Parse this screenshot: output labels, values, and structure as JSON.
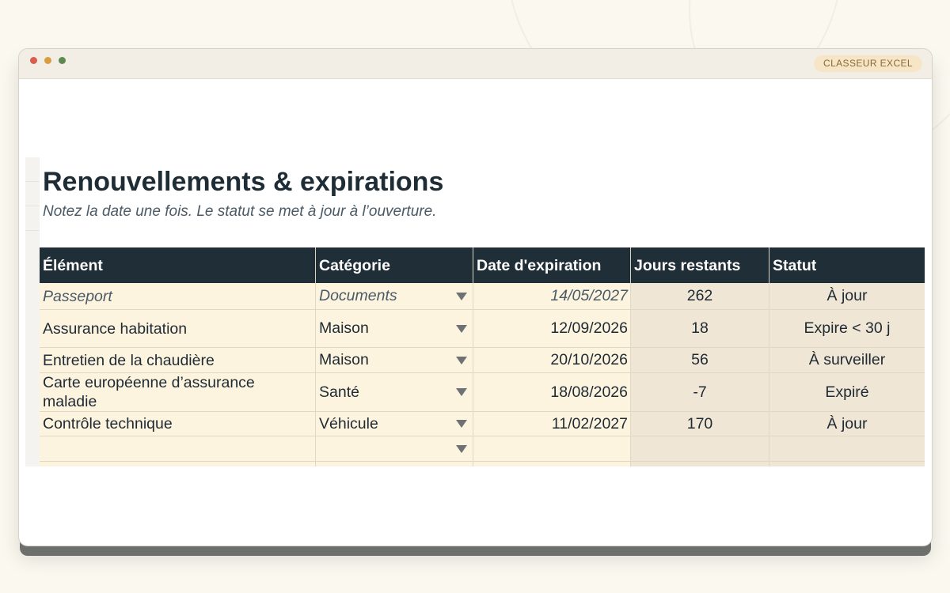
{
  "window": {
    "badge": "CLASSEUR EXCEL"
  },
  "sheet": {
    "title": "Renouvellements & expirations",
    "subtitle": "Notez la date une fois. Le statut se met à jour à l’ouverture."
  },
  "table": {
    "headers": [
      "Élément",
      "Catégorie",
      "Date d'expiration",
      "Jours restants",
      "Statut"
    ],
    "rows": [
      {
        "element": "Passeport",
        "category": "Documents",
        "date": "14/05/2027",
        "days": "262",
        "status": "À jour"
      },
      {
        "element": "Assurance habitation",
        "category": "Maison",
        "date": "12/09/2026",
        "days": "18",
        "status": "Expire < 30 j"
      },
      {
        "element": "Entretien de la chaudière",
        "category": "Maison",
        "date": "20/10/2026",
        "days": "56",
        "status": "À surveiller"
      },
      {
        "element": "Carte européenne d’assurance maladie",
        "category": "Santé",
        "date": "18/08/2026",
        "days": "-7",
        "status": "Expiré"
      },
      {
        "element": "Contrôle technique",
        "category": "Véhicule",
        "date": "11/02/2027",
        "days": "170",
        "status": "À jour"
      },
      {
        "element": "",
        "category": "",
        "date": "",
        "days": "",
        "status": ""
      }
    ]
  },
  "icons": {
    "dropdown": "chevron-down-icon"
  },
  "colors": {
    "window_dot_close": "#d65f4f",
    "window_dot_min": "#d89d3e",
    "window_dot_max": "#5c8a4e",
    "header_bg": "#1f2e37",
    "input_cell_bg": "#fdf4df",
    "computed_cell_bg": "#efe6d5"
  }
}
